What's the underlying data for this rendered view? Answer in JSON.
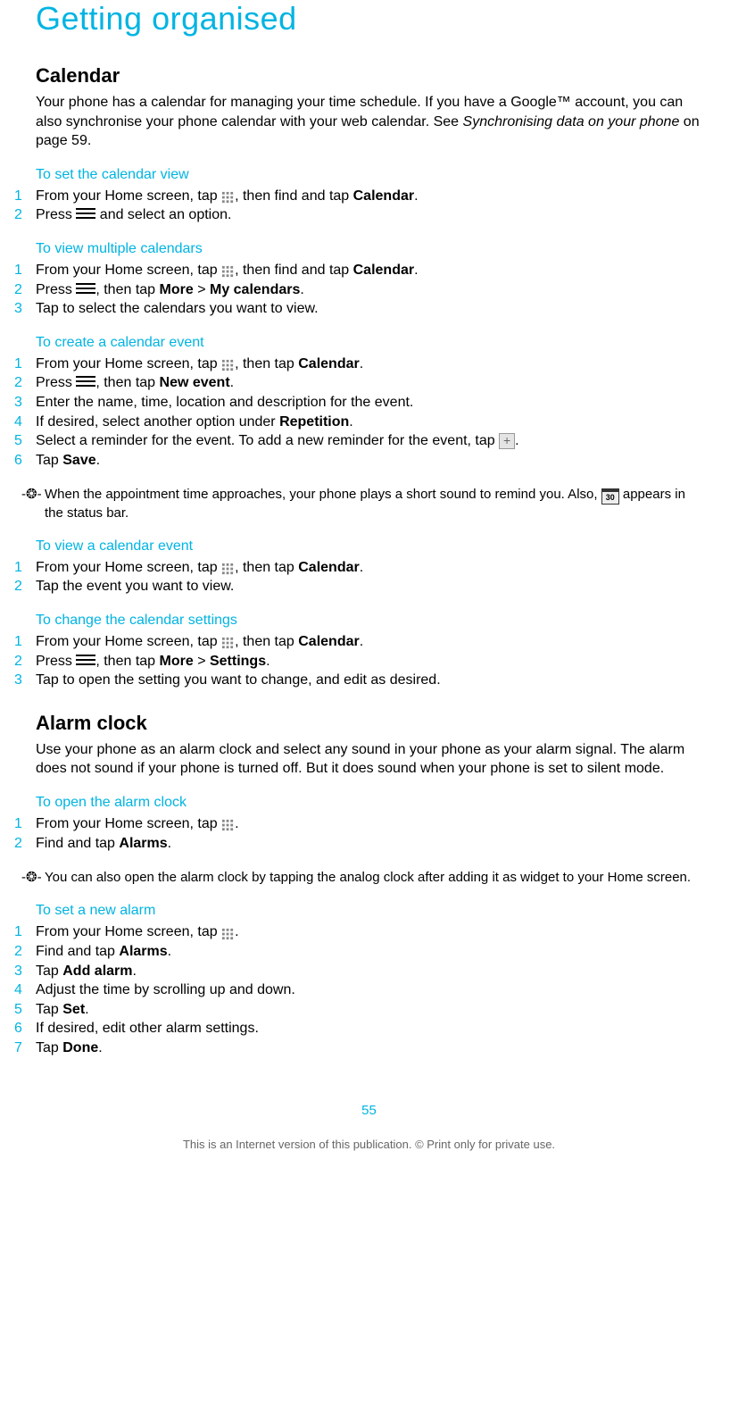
{
  "title": "Getting organised",
  "calendar": {
    "heading": "Calendar",
    "intro_pre": "Your phone has a calendar for managing your time schedule. If you have a Google™ account, you can also synchronise your phone calendar with your web calendar. See ",
    "intro_link": "Synchronising data on your phone",
    "intro_post": " on page 59.",
    "set_view": {
      "heading": "To set the calendar view",
      "s1_a": "From your Home screen, tap ",
      "s1_b": ", then find and tap ",
      "s1_c": "Calendar",
      "s1_d": ".",
      "s2_a": "Press ",
      "s2_b": " and select an option."
    },
    "multiple": {
      "heading": "To view multiple calendars",
      "s1_a": "From your Home screen, tap ",
      "s1_b": ", then find and tap ",
      "s1_c": "Calendar",
      "s1_d": ".",
      "s2_a": "Press ",
      "s2_b": ", then tap ",
      "s2_c": "More",
      "s2_d": " > ",
      "s2_e": "My calendars",
      "s2_f": ".",
      "s3": "Tap to select the calendars you want to view."
    },
    "create": {
      "heading": "To create a calendar event",
      "s1_a": "From your Home screen, tap ",
      "s1_b": ", then tap ",
      "s1_c": "Calendar",
      "s1_d": ".",
      "s2_a": "Press ",
      "s2_b": ", then tap ",
      "s2_c": "New event",
      "s2_d": ".",
      "s3": "Enter the name, time, location and description for the event.",
      "s4_a": "If desired, select another option under ",
      "s4_b": "Repetition",
      "s4_c": ".",
      "s5_a": "Select a reminder for the event. To add a new reminder for the event, tap ",
      "s5_b": ".",
      "s6_a": "Tap ",
      "s6_b": "Save",
      "s6_c": ".",
      "tip_a": "When the appointment time approaches, your phone plays a short sound to remind you. Also, ",
      "tip_b": " appears in the status bar."
    },
    "view_event": {
      "heading": "To view a calendar event",
      "s1_a": "From your Home screen, tap ",
      "s1_b": ", then tap ",
      "s1_c": "Calendar",
      "s1_d": ".",
      "s2": "Tap the event you want to view."
    },
    "change": {
      "heading": "To change the calendar settings",
      "s1_a": "From your Home screen, tap ",
      "s1_b": ", then tap ",
      "s1_c": "Calendar",
      "s1_d": ".",
      "s2_a": "Press ",
      "s2_b": ", then tap ",
      "s2_c": "More",
      "s2_d": " > ",
      "s2_e": "Settings",
      "s2_f": ".",
      "s3": "Tap to open the setting you want to change, and edit as desired."
    }
  },
  "alarm": {
    "heading": "Alarm clock",
    "intro": "Use your phone as an alarm clock and select any sound in your phone as your alarm signal. The alarm does not sound if your phone is turned off. But it does sound when your phone is set to silent mode.",
    "open": {
      "heading": "To open the alarm clock",
      "s1_a": "From your Home screen, tap ",
      "s1_b": ".",
      "s2_a": "Find and tap ",
      "s2_b": "Alarms",
      "s2_c": ".",
      "tip": "You can also open the alarm clock by tapping the analog clock after adding it as widget to your Home screen."
    },
    "set": {
      "heading": "To set a new alarm",
      "s1_a": "From your Home screen, tap ",
      "s1_b": ".",
      "s2_a": "Find and tap ",
      "s2_b": "Alarms",
      "s2_c": ".",
      "s3_a": "Tap ",
      "s3_b": "Add alarm",
      "s3_c": ".",
      "s4": "Adjust the time by scrolling up and down.",
      "s5_a": "Tap ",
      "s5_b": "Set",
      "s5_c": ".",
      "s6": "If desired, edit other alarm settings.",
      "s7_a": "Tap ",
      "s7_b": "Done",
      "s7_c": "."
    }
  },
  "nums": {
    "n1": "1",
    "n2": "2",
    "n3": "3",
    "n4": "4",
    "n5": "5",
    "n6": "6",
    "n7": "7"
  },
  "footer": {
    "page": "55",
    "note": "This is an Internet version of this publication. © Print only for private use."
  },
  "cal30": "30"
}
